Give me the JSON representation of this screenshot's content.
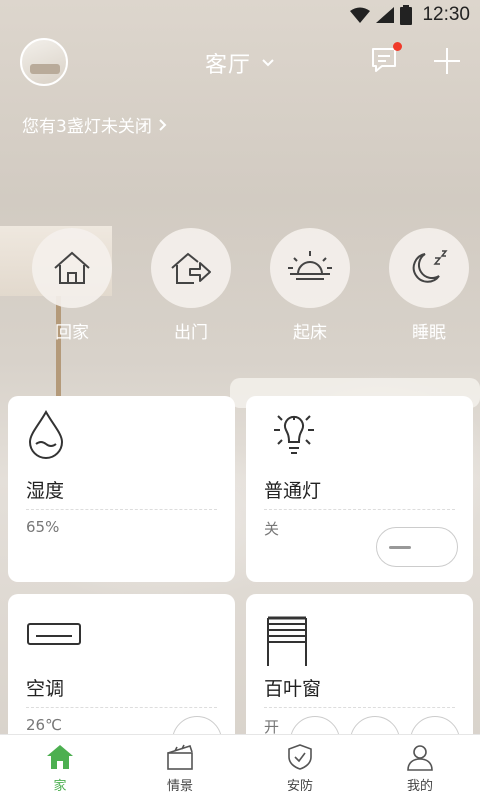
{
  "status": {
    "time": "12:30"
  },
  "header": {
    "room": "客厅"
  },
  "notice": {
    "text": "您有3盏灯未关闭"
  },
  "scenes": [
    {
      "label": "回家",
      "icon": "home-icon"
    },
    {
      "label": "出门",
      "icon": "leave-home-icon"
    },
    {
      "label": "起床",
      "icon": "sunrise-icon"
    },
    {
      "label": "睡眠",
      "icon": "moon-sleep-icon"
    }
  ],
  "cards": {
    "humidity": {
      "title": "湿度",
      "value": "65%",
      "icon": "water-drop-icon"
    },
    "light": {
      "title": "普通灯",
      "value": "关",
      "icon": "light-bulb-icon"
    },
    "ac": {
      "title": "空调",
      "value": "26℃",
      "icon": "air-conditioner-icon"
    },
    "blinds": {
      "title": "百叶窗",
      "value": "开",
      "icon": "blinds-icon"
    }
  },
  "tabs": [
    {
      "label": "家",
      "icon": "home-icon",
      "active": true
    },
    {
      "label": "情景",
      "icon": "clapperboard-icon"
    },
    {
      "label": "安防",
      "icon": "shield-icon"
    },
    {
      "label": "我的",
      "icon": "user-icon"
    }
  ],
  "colors": {
    "accent": "#4caf50",
    "badge": "#f03a2a"
  }
}
